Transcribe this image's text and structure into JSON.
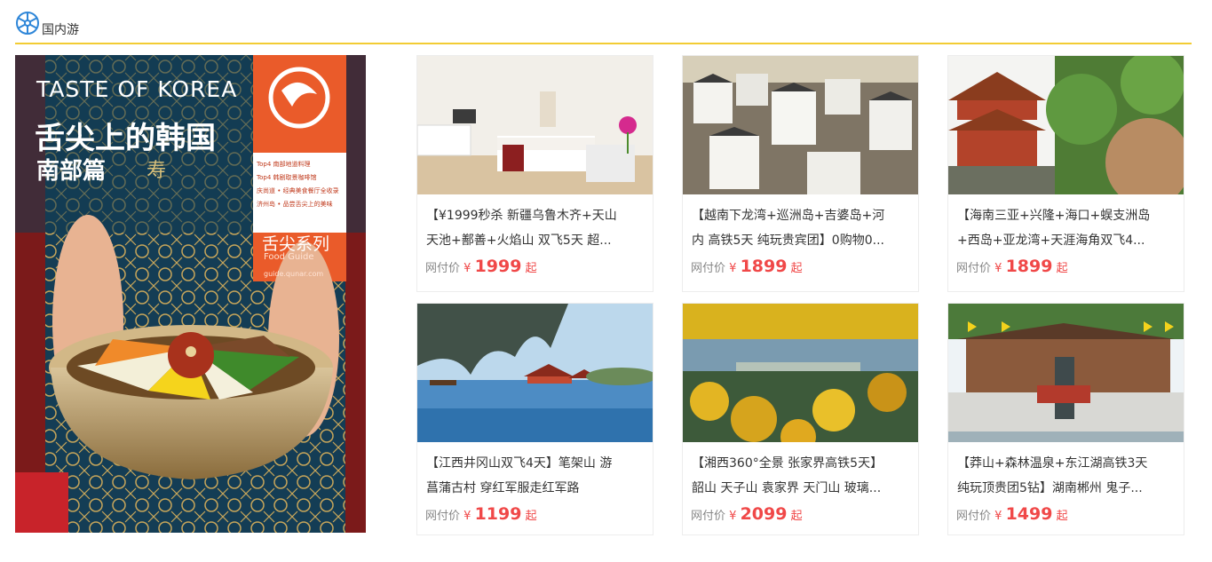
{
  "section": {
    "title": "国内游",
    "icon": "wheel-icon",
    "accent_color": "#f2cc33"
  },
  "banner": {
    "title_en": "TASTE OF KOREA",
    "title_cn": "舌尖上的韩国",
    "subtitle_cn": "南部篇",
    "list": [
      "Top4 南部地道料理",
      "Top4 韩剧取景咖啡馆",
      "庆尚道 • 经典美食餐厅全收录",
      "济州岛 • 品尝舌尖上的美味"
    ],
    "series_cn": "舌尖系列",
    "series_en": "Food Guide",
    "url": "guide.qunar.com",
    "seal": "寿"
  },
  "price_label": "网付价",
  "currency": "¥",
  "suffix": "起",
  "price_color": "#f04848",
  "products": [
    {
      "line1": "【¥1999秒杀 新疆乌鲁木齐+天山",
      "line2": "天池+鄯善+火焰山 双飞5天 超...",
      "price": "1999",
      "image": "hotel-room-photo"
    },
    {
      "line1": "【越南下龙湾+巡洲岛+吉婆岛+河",
      "line2": "内 高铁5天 纯玩贵宾团】0购物0...",
      "price": "1899",
      "image": "village-rooftops-photo"
    },
    {
      "line1": "【海南三亚+兴隆+海口+蜈支洲岛",
      "line2": "+西岛+亚龙湾+天涯海角双飞4...",
      "price": "1899",
      "image": "temple-photo"
    },
    {
      "line1": "【江西井冈山双飞4天】笔架山 游",
      "line2": "菖蒲古村 穿红军服走红军路",
      "price": "1199",
      "image": "lake-pavilion-photo"
    },
    {
      "line1": "【湘西360°全景 张家界高铁5天】",
      "line2": "韶山 天子山 袁家界 天门山 玻璃...",
      "price": "2099",
      "image": "autumn-forest-photo"
    },
    {
      "line1": "【莽山+森林温泉+东江湖高铁3天",
      "line2": "纯玩顶贵团5钻】湖南郴州 鬼子...",
      "price": "1499",
      "image": "temple-fountain-photo"
    }
  ]
}
